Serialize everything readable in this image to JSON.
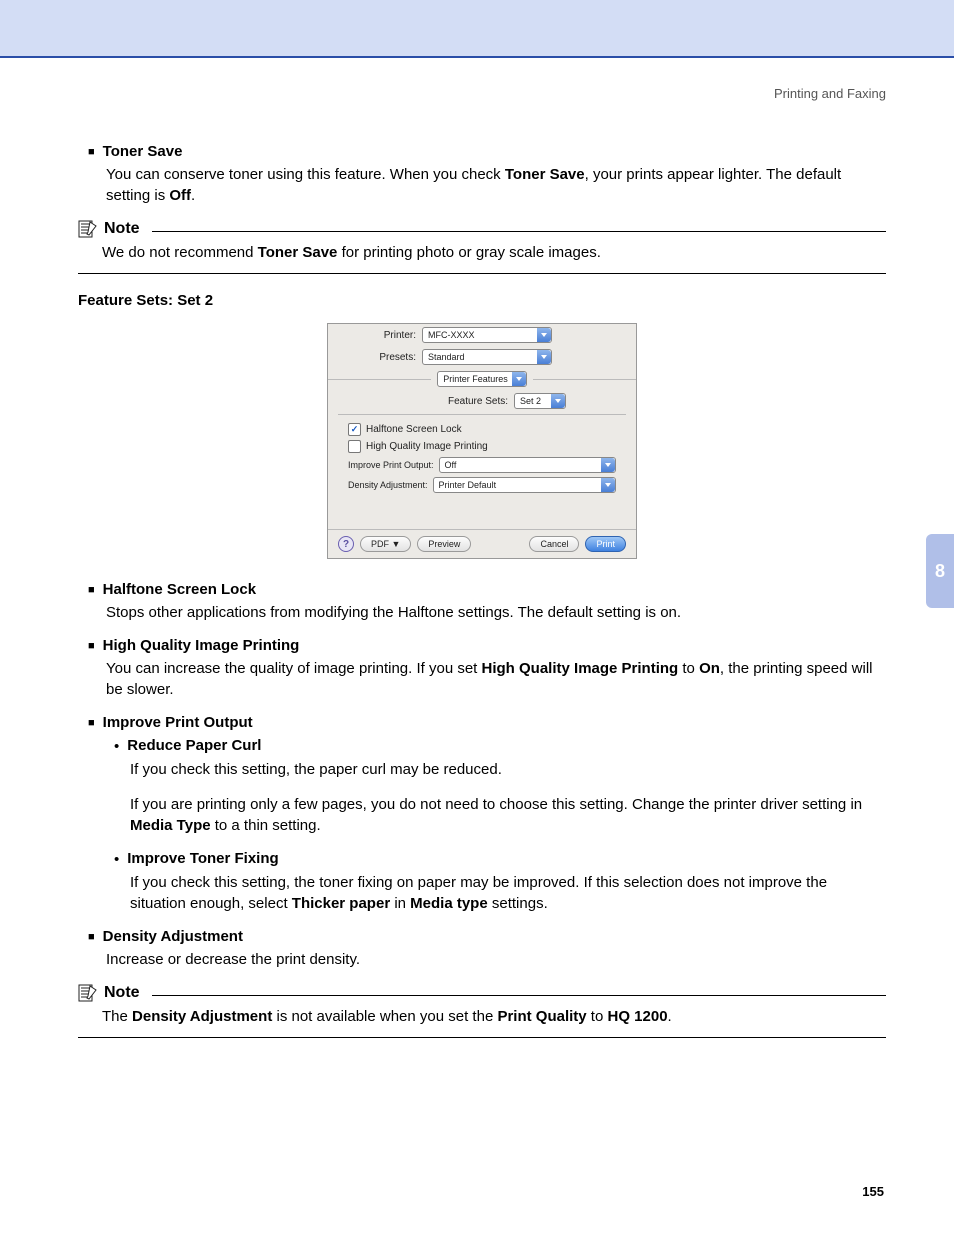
{
  "header": {
    "section": "Printing and Faxing"
  },
  "side_tab": {
    "number": "8"
  },
  "page_number": "155",
  "items": {
    "toner_save": {
      "title": "Toner Save",
      "body_pre": "You can conserve toner using this feature. When you check ",
      "body_bold1": "Toner Save",
      "body_mid": ", your prints appear lighter. The default setting is ",
      "body_bold2": "Off",
      "body_post": "."
    },
    "halftone": {
      "title": "Halftone Screen Lock",
      "body": "Stops other applications from modifying the Halftone settings. The default setting is on."
    },
    "hq_image": {
      "title": "High Quality Image Printing",
      "body_pre": "You can increase the quality of image printing. If you set ",
      "body_bold1": "High Quality Image Printing",
      "body_mid": " to ",
      "body_bold2": "On",
      "body_post": ", the printing speed will be slower."
    },
    "improve_out": {
      "title": "Improve Print Output"
    },
    "reduce_curl": {
      "title": "Reduce Paper Curl",
      "body1": "If you check this setting, the paper curl may be reduced.",
      "body2_pre": "If you are printing only a few pages, you do not need to choose this setting. Change the printer driver setting in ",
      "body2_bold": "Media Type",
      "body2_post": " to a thin setting."
    },
    "toner_fix": {
      "title": "Improve Toner Fixing",
      "body_pre": "If you check this setting, the toner fixing on paper may be improved. If this selection does not improve the situation enough, select ",
      "body_bold1": "Thicker paper",
      "body_mid": " in ",
      "body_bold2": "Media type",
      "body_post": " settings."
    },
    "density_adj": {
      "title": "Density Adjustment",
      "body": "Increase or decrease the print density."
    }
  },
  "notes": {
    "label": "Note",
    "n1_pre": "We do not recommend ",
    "n1_bold": "Toner Save",
    "n1_post": " for printing photo or gray scale images.",
    "n2_pre": "The ",
    "n2_b1": "Density Adjustment",
    "n2_mid1": " is not available when you set the ",
    "n2_b2": "Print Quality",
    "n2_mid2": " to ",
    "n2_b3": "HQ 1200",
    "n2_post": "."
  },
  "feature_sets_heading": "Feature Sets: Set 2",
  "dialog": {
    "printer_label": "Printer:",
    "printer_value": "MFC-XXXX",
    "presets_label": "Presets:",
    "presets_value": "Standard",
    "pane_value": "Printer Features",
    "fs_label": "Feature Sets:",
    "fs_value": "Set 2",
    "chk_halftone": "Halftone Screen Lock",
    "chk_hq": "High Quality Image Printing",
    "improve_label": "Improve Print Output:",
    "improve_value": "Off",
    "density_label": "Density Adjustment:",
    "density_value": "Printer Default",
    "help": "?",
    "pdf": "PDF ▼",
    "preview": "Preview",
    "cancel": "Cancel",
    "print": "Print"
  }
}
